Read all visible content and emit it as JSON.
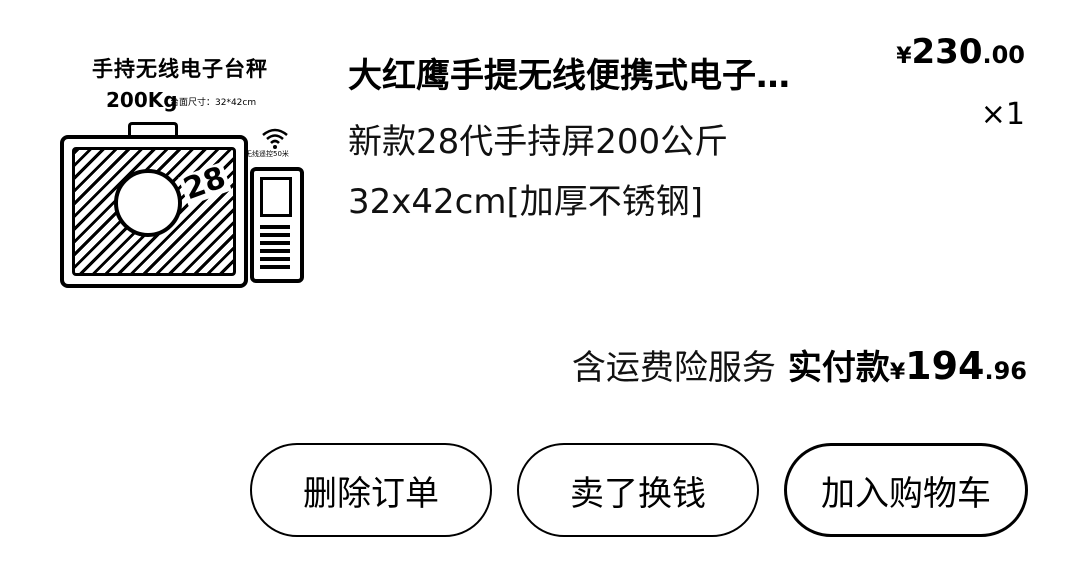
{
  "product": {
    "image_title": "手持无线电子台秤",
    "image_capacity": "200Kg",
    "image_spec": "台面尺寸：32*42cm",
    "image_badge_number": "28",
    "image_wifi_label": "无线遥控50米",
    "title": "大红鹰手提无线便携式电子…",
    "spec_line1": "新款28代手持屏200公斤",
    "spec_line2": "32x42cm[加厚不锈钢]",
    "price": {
      "currency": "¥",
      "integer": "230",
      "decimal": ".00"
    },
    "quantity": "×1"
  },
  "summary": {
    "service_text": "含运费险服务",
    "paid_label": "实付款",
    "paid": {
      "currency": "¥",
      "integer": "194",
      "decimal": ".96"
    }
  },
  "actions": {
    "delete": "删除订单",
    "sell": "卖了换钱",
    "add_to_cart": "加入购物车"
  }
}
